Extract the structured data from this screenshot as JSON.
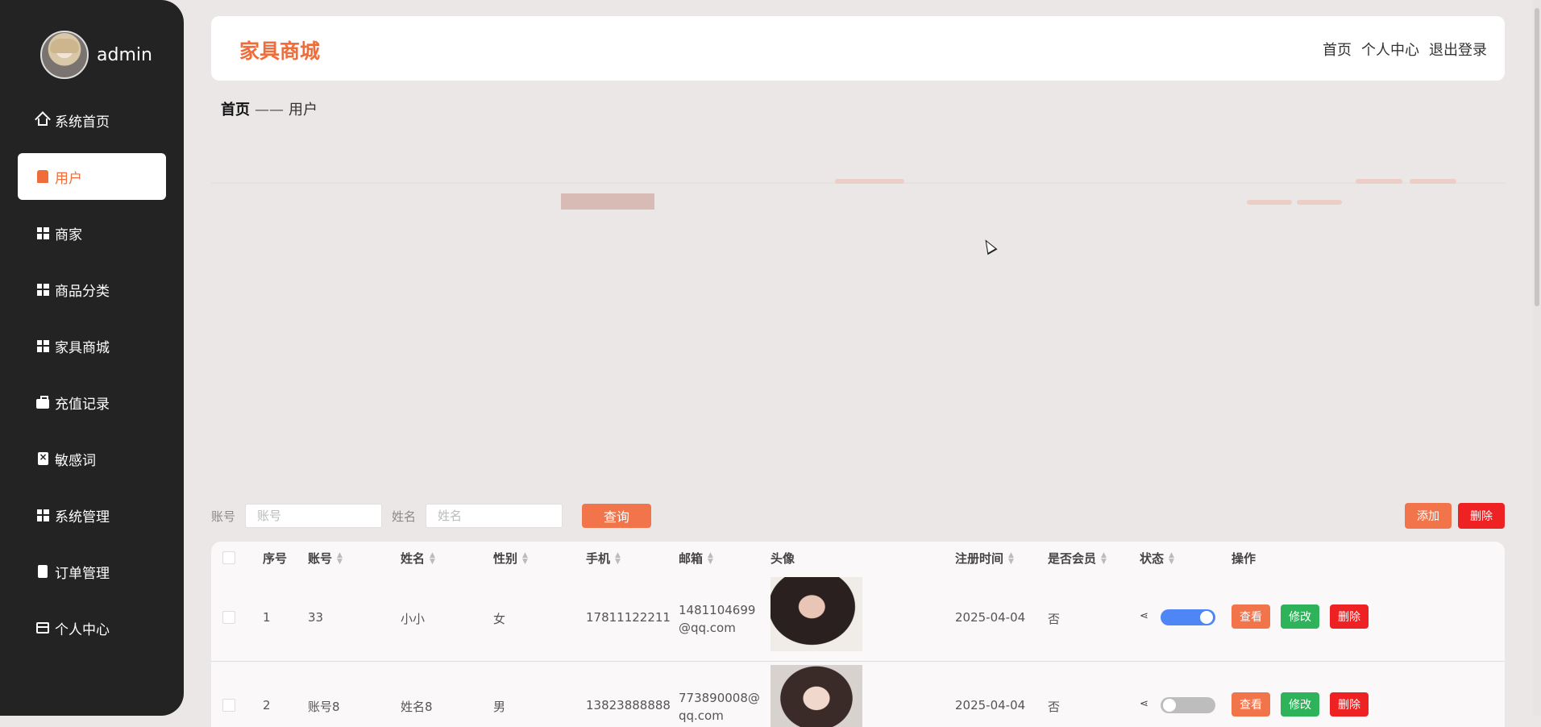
{
  "sidebar": {
    "admin": "admin",
    "items": [
      {
        "label": "系统首页",
        "icon": "home-icon"
      },
      {
        "label": "用户",
        "icon": "user-icon",
        "active": true
      },
      {
        "label": "商家",
        "icon": "grid-icon"
      },
      {
        "label": "商品分类",
        "icon": "grid-icon"
      },
      {
        "label": "家具商城",
        "icon": "grid-icon"
      },
      {
        "label": "充值记录",
        "icon": "briefcase-icon"
      },
      {
        "label": "敏感词",
        "icon": "clipboard-icon"
      },
      {
        "label": "系统管理",
        "icon": "grid-icon"
      },
      {
        "label": "订单管理",
        "icon": "order-icon"
      },
      {
        "label": "个人中心",
        "icon": "card-icon"
      }
    ]
  },
  "header": {
    "brand": "家具商城",
    "links": [
      "首页",
      "个人中心",
      "退出登录"
    ]
  },
  "breadcrumb": {
    "home": "首页",
    "sep": "——",
    "current": "用户"
  },
  "search": {
    "account_label": "账号",
    "account_placeholder": "账号",
    "name_label": "姓名",
    "name_placeholder": "姓名",
    "query_label": "查询"
  },
  "actions": {
    "add_label": "添加",
    "delete_label": "删除"
  },
  "table": {
    "columns": [
      "序号",
      "账号",
      "姓名",
      "性别",
      "手机",
      "邮箱",
      "头像",
      "注册时间",
      "是否会员",
      "状态",
      "操作"
    ],
    "rows": [
      {
        "index": "1",
        "account": "33",
        "name": "小小",
        "gender": "女",
        "phone": "17811122211",
        "email_line1": "1481104699",
        "email_line2": "@qq.com",
        "reg_time": "2025-04-04",
        "member": "否",
        "status_on": true
      },
      {
        "index": "2",
        "account": "账号8",
        "name": "姓名8",
        "gender": "男",
        "phone": "13823888888",
        "email_line1": "773890008@",
        "email_line2": "qq.com",
        "reg_time": "2025-04-04",
        "member": "否",
        "status_on": false
      }
    ],
    "row_actions": {
      "view": "查看",
      "edit": "修改",
      "delete": "删除"
    }
  },
  "colors": {
    "accent": "#ef6d3b",
    "sidebar_bg": "#232323",
    "edit": "#2fb35a",
    "danger": "#ee2222",
    "switch_on": "#4e86f5"
  }
}
